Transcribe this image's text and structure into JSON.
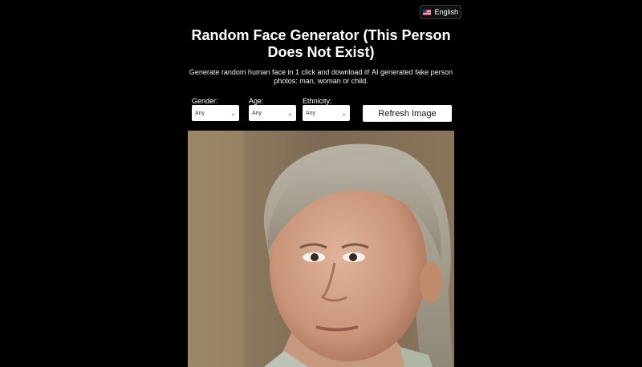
{
  "language": {
    "label": "English",
    "icon": "us-flag-icon"
  },
  "header": {
    "title": "Random Face Generator (This Person Does Not Exist)",
    "subtitle": "Generate random human face in 1 click and download it! AI generated fake person photos: man, woman or child."
  },
  "filters": {
    "gender": {
      "label": "Gender:",
      "value": "Any"
    },
    "age": {
      "label": "Age:",
      "value": "Any"
    },
    "ethnicity": {
      "label": "Ethnicity:",
      "value": "Any"
    }
  },
  "refresh_label": "Refresh Image",
  "colors": {
    "background": "#000000",
    "text": "#ffffff",
    "control": "#ffffff"
  }
}
